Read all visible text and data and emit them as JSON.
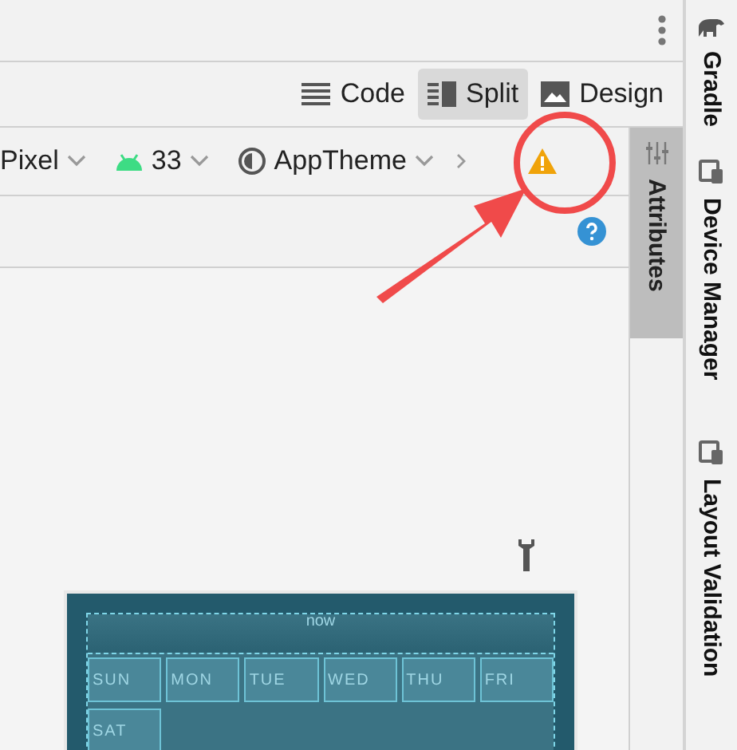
{
  "view_modes": [
    {
      "label": "Code",
      "kind": "code",
      "selected": false
    },
    {
      "label": "Split",
      "kind": "split",
      "selected": true
    },
    {
      "label": "Design",
      "kind": "design",
      "selected": false
    }
  ],
  "toolbar": {
    "device": "Pixel",
    "api_level": "33",
    "theme": "AppTheme",
    "warning": true
  },
  "attributes_tab": {
    "label": "Attributes",
    "selected": true
  },
  "side_tools": [
    {
      "label": "Gradle",
      "kind": "gradle"
    },
    {
      "label": "Device Manager",
      "kind": "device"
    },
    {
      "label": "Layout Validation",
      "kind": "device"
    }
  ],
  "preview": {
    "title": "now",
    "days": [
      "SUN",
      "MON",
      "TUE",
      "WED",
      "THU",
      "FRI",
      "SAT"
    ]
  }
}
